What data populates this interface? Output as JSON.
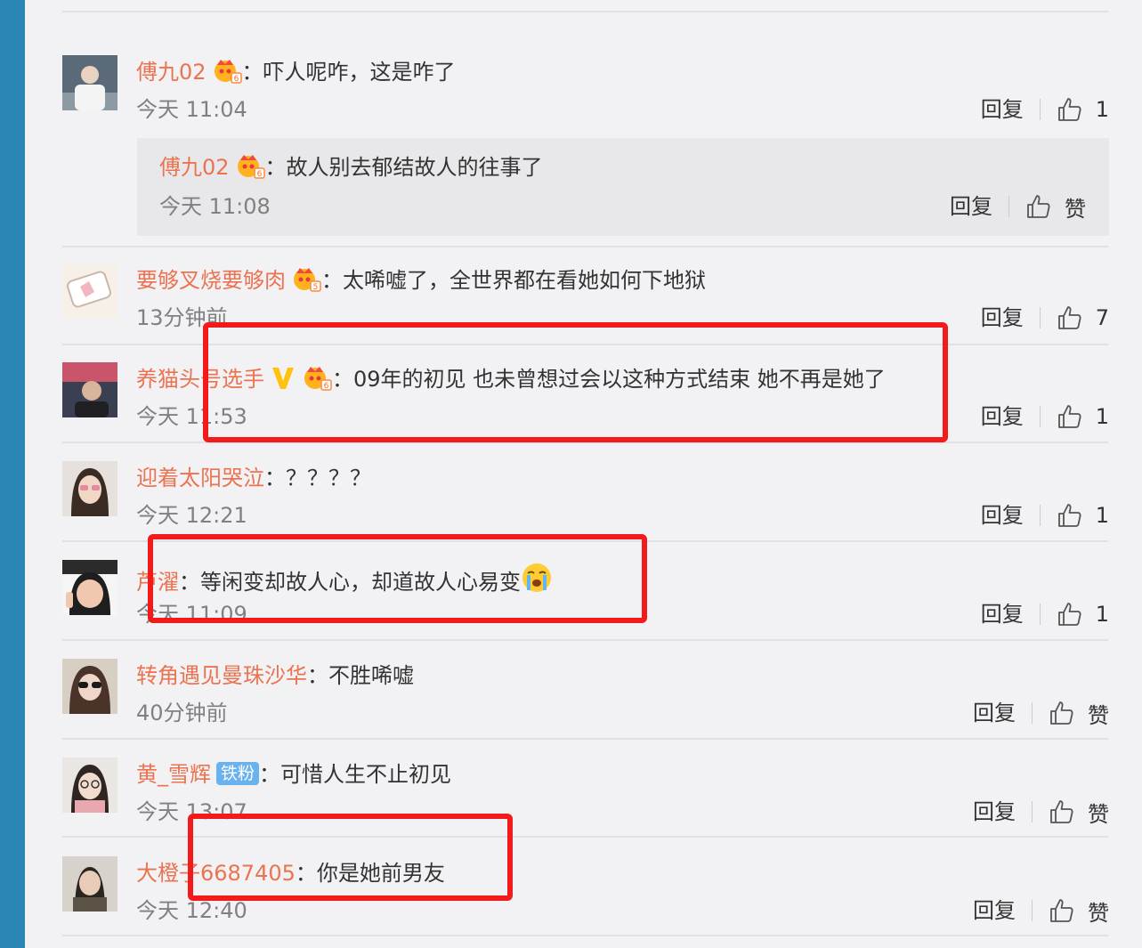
{
  "labels": {
    "reply": "回复"
  },
  "colors": {
    "username": "#eb7350",
    "highlight": "#f21a1a",
    "sidebar": "#2a86b2"
  },
  "comments": [
    {
      "user": "傅九02",
      "badge": "vip-crown-icon",
      "text": "吓人呢咋，这是咋了",
      "time": "今天 11:04",
      "likes": "1"
    },
    {
      "user": "要够叉烧要够肉",
      "badge": "vip-crown-icon",
      "text": "太唏嘘了，全世界都在看她如何下地狱",
      "time": "13分钟前",
      "likes": "7"
    },
    {
      "user": "养猫头号选手",
      "badge": "verified-v-icon",
      "text": "09年的初见 也未曾想过会以这种方式结束 她不再是她了",
      "time": "今天 11:53",
      "likes": "1"
    },
    {
      "user": "迎着太阳哭泣",
      "text": "？？？？",
      "time": "今天 12:21",
      "likes": "1"
    },
    {
      "user": "芦濯",
      "text": "等闲变却故人心，却道故人心易变",
      "emoji": "crying-face-icon",
      "time": "今天 11:09",
      "likes": "1"
    },
    {
      "user": "转角遇见曼珠沙华",
      "text": "不胜唏嘘",
      "time": "40分钟前",
      "likes": "赞"
    },
    {
      "user": "黄_雪辉",
      "fan_badge": "铁粉",
      "text": "可惜人生不止初见",
      "time": "今天 13:07",
      "likes": "赞"
    },
    {
      "user": "大橙子6687405",
      "text": "你是她前男友",
      "time": "今天 12:40",
      "likes": "赞"
    }
  ],
  "nested_reply": {
    "user": "傅九02",
    "badge": "vip-crown-icon",
    "text": "故人别去郁结故人的往事了",
    "time": "今天 11:08",
    "likes": "赞"
  }
}
